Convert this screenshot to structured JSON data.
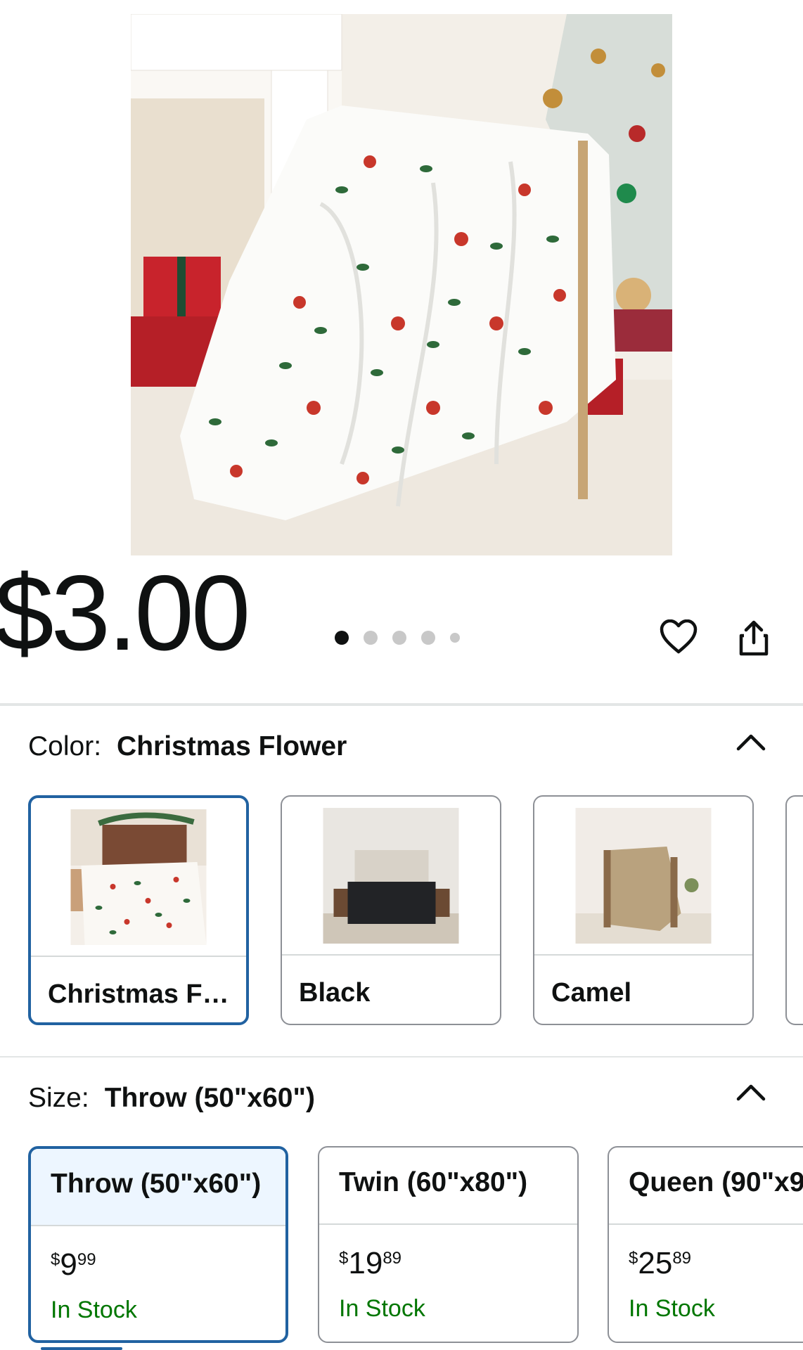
{
  "product": {
    "price": "$3.00",
    "image_carousel": {
      "count": 5,
      "active_index": 0
    },
    "actions": {
      "favorite_icon": "heart-icon",
      "share_icon": "share-icon"
    }
  },
  "color_section": {
    "label": "Color:",
    "selected_value": "Christmas Flower",
    "options": [
      {
        "label": "Christmas F…",
        "selected": true
      },
      {
        "label": "Black",
        "selected": false
      },
      {
        "label": "Camel",
        "selected": false
      }
    ]
  },
  "size_section": {
    "label": "Size:",
    "selected_value": "Throw (50\"x60\")",
    "options": [
      {
        "label": "Throw (50\"x60\")",
        "price_symbol": "$",
        "price_whole": "9",
        "price_fraction": "99",
        "stock": "In Stock",
        "selected": true
      },
      {
        "label": "Twin (60\"x80\")",
        "price_symbol": "$",
        "price_whole": "19",
        "price_fraction": "89",
        "stock": "In Stock",
        "selected": false
      },
      {
        "label": "Queen (90\"x9",
        "price_symbol": "$",
        "price_whole": "25",
        "price_fraction": "89",
        "stock": "In Stock",
        "selected": false
      }
    ]
  },
  "colors": {
    "selected_border": "#2162a1",
    "selected_fill": "#edf6ff",
    "in_stock": "#007600",
    "divider": "#e3e6e6"
  }
}
